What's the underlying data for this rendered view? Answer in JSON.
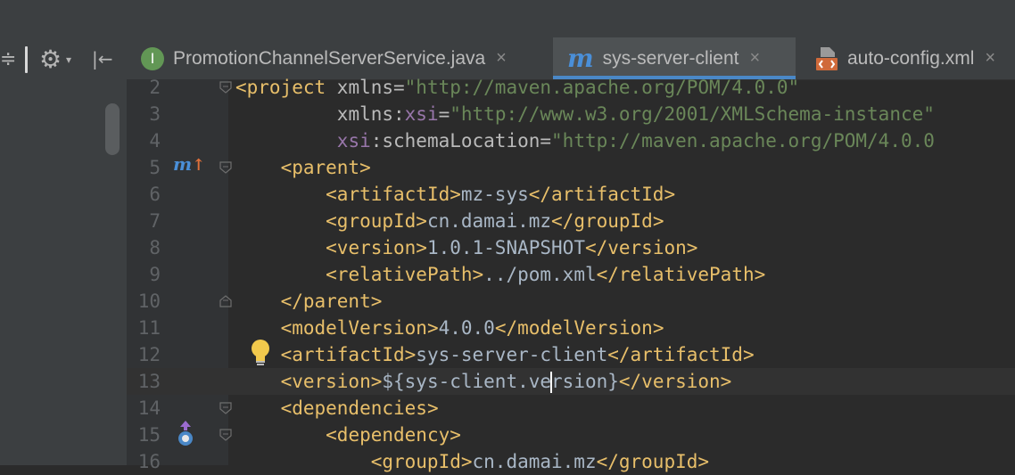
{
  "tabs": [
    {
      "label": "PromotionChannelServerService.java",
      "icon": "interface-icon",
      "icon_letter": "I",
      "active": false
    },
    {
      "label": "sys-server-client",
      "icon": "maven-icon",
      "icon_letter": "m",
      "active": true
    },
    {
      "label": "auto-config.xml",
      "icon": "xml-file-icon",
      "active": false
    }
  ],
  "close_glyph": "×",
  "toolbar": {
    "gear_glyph": "⚙",
    "gear_arrow": "▾",
    "hide_glyph": "|←"
  },
  "gutter_icons": {
    "line5": "m↑",
    "line12": "lightbulb-icon",
    "line15": "override-up-icon"
  },
  "colors": {
    "tag": "#e8bf6a",
    "attr": "#bababa",
    "namespace": "#9876aa",
    "string": "#6a8759",
    "text": "#a9b7c6",
    "accent": "#4a88c7"
  },
  "lines": [
    {
      "num": "2",
      "parts": [
        [
          "t",
          "<project "
        ],
        [
          "a",
          "xmlns="
        ],
        [
          "s",
          "\"http://maven.apache.org/POM/4.0.0\""
        ]
      ]
    },
    {
      "num": "3",
      "parts": [
        [
          "txt",
          "         "
        ],
        [
          "a",
          "xmlns:"
        ],
        [
          "ns",
          "xsi"
        ],
        [
          "a",
          "="
        ],
        [
          "s",
          "\"http://www.w3.org/2001/XMLSchema-instance\""
        ]
      ]
    },
    {
      "num": "4",
      "parts": [
        [
          "txt",
          "         "
        ],
        [
          "ns",
          "xsi"
        ],
        [
          "a",
          ":schemaLocation="
        ],
        [
          "s",
          "\"http://maven.apache.org/POM/4.0.0"
        ]
      ]
    },
    {
      "num": "5",
      "parts": [
        [
          "txt",
          "    "
        ],
        [
          "t",
          "<parent>"
        ]
      ]
    },
    {
      "num": "6",
      "parts": [
        [
          "txt",
          "        "
        ],
        [
          "t",
          "<artifactId>"
        ],
        [
          "txt",
          "mz-sys"
        ],
        [
          "t",
          "</artifactId>"
        ]
      ]
    },
    {
      "num": "7",
      "parts": [
        [
          "txt",
          "        "
        ],
        [
          "t",
          "<groupId>"
        ],
        [
          "txt",
          "cn.damai.mz"
        ],
        [
          "t",
          "</groupId>"
        ]
      ]
    },
    {
      "num": "8",
      "parts": [
        [
          "txt",
          "        "
        ],
        [
          "t",
          "<version>"
        ],
        [
          "txt",
          "1.0.1-SNAPSHOT"
        ],
        [
          "t",
          "</version>"
        ]
      ]
    },
    {
      "num": "9",
      "parts": [
        [
          "txt",
          "        "
        ],
        [
          "t",
          "<relativePath>"
        ],
        [
          "txt",
          "../pom.xml"
        ],
        [
          "t",
          "</relativePath>"
        ]
      ]
    },
    {
      "num": "10",
      "parts": [
        [
          "txt",
          "    "
        ],
        [
          "t",
          "</parent>"
        ]
      ]
    },
    {
      "num": "11",
      "parts": [
        [
          "txt",
          "    "
        ],
        [
          "t",
          "<modelVersion>"
        ],
        [
          "txt",
          "4.0.0"
        ],
        [
          "t",
          "</modelVersion>"
        ]
      ]
    },
    {
      "num": "12",
      "parts": [
        [
          "txt",
          "    "
        ],
        [
          "t",
          "<artifactId>"
        ],
        [
          "txt",
          "sys-server-client"
        ],
        [
          "t",
          "</artifactId>"
        ]
      ]
    },
    {
      "num": "13",
      "parts": [
        [
          "txt",
          "    "
        ],
        [
          "t",
          "<version>"
        ],
        [
          "txt",
          "${sys-client.ve"
        ],
        [
          "caret",
          ""
        ],
        [
          "txt",
          "rsion}"
        ],
        [
          "t",
          "</version>"
        ]
      ]
    },
    {
      "num": "14",
      "parts": [
        [
          "txt",
          "    "
        ],
        [
          "t",
          "<dependencies>"
        ]
      ]
    },
    {
      "num": "15",
      "parts": [
        [
          "txt",
          "        "
        ],
        [
          "t",
          "<dependency>"
        ]
      ]
    },
    {
      "num": "16",
      "parts": [
        [
          "txt",
          "            "
        ],
        [
          "t",
          "<groupId>"
        ],
        [
          "txt",
          "cn.damai.mz"
        ],
        [
          "t",
          "</groupId>"
        ]
      ]
    }
  ]
}
